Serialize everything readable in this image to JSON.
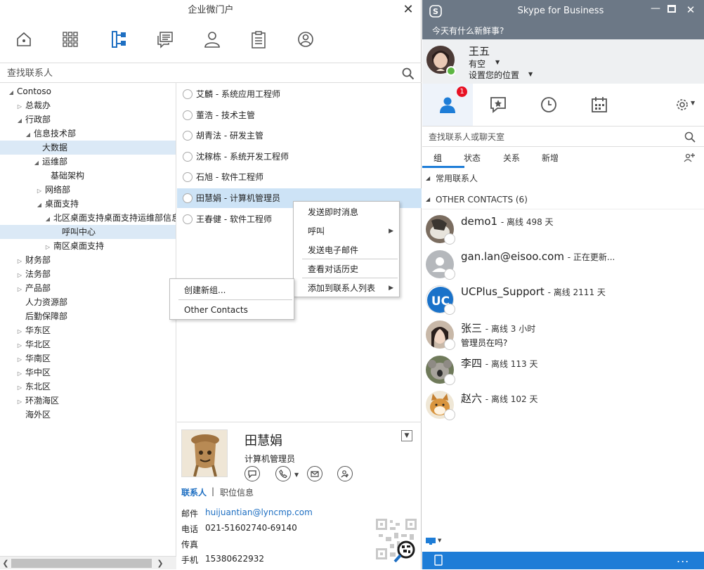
{
  "left": {
    "title": "企业微门户",
    "search_placeholder": "查找联系人",
    "nav_icons": [
      "home-icon",
      "apps-grid-icon",
      "org-tree-icon",
      "chat-icon",
      "person-icon",
      "clipboard-icon",
      "profile-icon"
    ],
    "tree": [
      {
        "label": "Contoso",
        "arrow": "expanded"
      },
      {
        "label": "总裁办",
        "arrow": "collapsed"
      },
      {
        "label": "行政部",
        "arrow": "expanded"
      },
      {
        "label": "信息技术部",
        "arrow": "expanded"
      },
      {
        "label": "大数据",
        "arrow": "none",
        "selected": true
      },
      {
        "label": "运维部",
        "arrow": "expanded"
      },
      {
        "label": "基础架构",
        "arrow": "none"
      },
      {
        "label": "网络部",
        "arrow": "collapsed"
      },
      {
        "label": "桌面支持",
        "arrow": "expanded"
      },
      {
        "label": "北区桌面支持桌面支持运维部信息",
        "arrow": "expanded"
      },
      {
        "label": "呼叫中心",
        "arrow": "none",
        "selected": true
      },
      {
        "label": "南区桌面支持",
        "arrow": "collapsed"
      },
      {
        "label": "财务部",
        "arrow": "collapsed"
      },
      {
        "label": "法务部",
        "arrow": "collapsed"
      },
      {
        "label": "产品部",
        "arrow": "collapsed"
      },
      {
        "label": "人力资源部",
        "arrow": "none"
      },
      {
        "label": "后勤保障部",
        "arrow": "none"
      },
      {
        "label": "华东区",
        "arrow": "collapsed"
      },
      {
        "label": "华北区",
        "arrow": "collapsed"
      },
      {
        "label": "华南区",
        "arrow": "collapsed"
      },
      {
        "label": "华中区",
        "arrow": "collapsed"
      },
      {
        "label": "东北区",
        "arrow": "collapsed"
      },
      {
        "label": "环渤海区",
        "arrow": "collapsed"
      },
      {
        "label": "海外区",
        "arrow": "none"
      }
    ],
    "members": [
      {
        "text": "艾麟 - 系统应用工程师"
      },
      {
        "text": "董浩 - 技术主管"
      },
      {
        "text": "胡青法 - 研发主管"
      },
      {
        "text": "沈稼栋 - 系统开发工程师"
      },
      {
        "text": "石旭 - 软件工程师"
      },
      {
        "text": "田慧娟 - 计算机管理员",
        "selected": true
      },
      {
        "text": "王春健 - 软件工程师"
      }
    ],
    "context_menu": [
      {
        "label": "发送即时消息",
        "submenu": false
      },
      {
        "label": "呼叫",
        "submenu": true
      },
      {
        "label": "发送电子邮件",
        "submenu": false
      },
      {
        "label": "查看对话历史",
        "submenu": false
      },
      {
        "label": "添加到联系人列表",
        "submenu": true
      }
    ],
    "submenu": [
      {
        "label": "创建新组..."
      },
      {
        "label": "Other Contacts"
      }
    ],
    "detail": {
      "name": "田慧娟",
      "title": "计算机管理员",
      "tab_contact": "联系人",
      "tab_sep": "|",
      "tab_job": "职位信息",
      "email_label": "邮件",
      "email": "huijuantian@lyncmp.com",
      "phone_label": "电话",
      "phone": "021-51602740-69140",
      "fax_label": "传真",
      "fax": "",
      "mobile_label": "手机",
      "mobile": "15380622932"
    }
  },
  "skype": {
    "title": "Skype for Business",
    "banner": "今天有什么新鲜事?",
    "user_name": "王五",
    "status": "有空",
    "location": "设置您的位置",
    "badge": "1",
    "search_placeholder": "查找联系人或聊天室",
    "subtabs": [
      "组",
      "状态",
      "关系",
      "新增"
    ],
    "groups": [
      {
        "label": "常用联系人"
      },
      {
        "label": "OTHER CONTACTS (6)"
      }
    ],
    "contacts": [
      {
        "name": "demo1",
        "status": "- 离线 498 天",
        "note": ""
      },
      {
        "name": "gan.lan@eisoo.com",
        "status": "- 正在更新...",
        "note": ""
      },
      {
        "name": "UCPlus_Support",
        "status": "- 离线 2111 天",
        "note": ""
      },
      {
        "name": "张三",
        "status": "- 离线 3 小时",
        "note": "管理员在吗?"
      },
      {
        "name": "李四",
        "status": "- 离线 113 天",
        "note": ""
      },
      {
        "name": "赵六",
        "status": "- 离线 102 天",
        "note": ""
      }
    ],
    "colors": {
      "title_bar": "#6c7886",
      "accent": "#1e7dd7",
      "online": "#5db643",
      "badge": "#e81123"
    }
  }
}
